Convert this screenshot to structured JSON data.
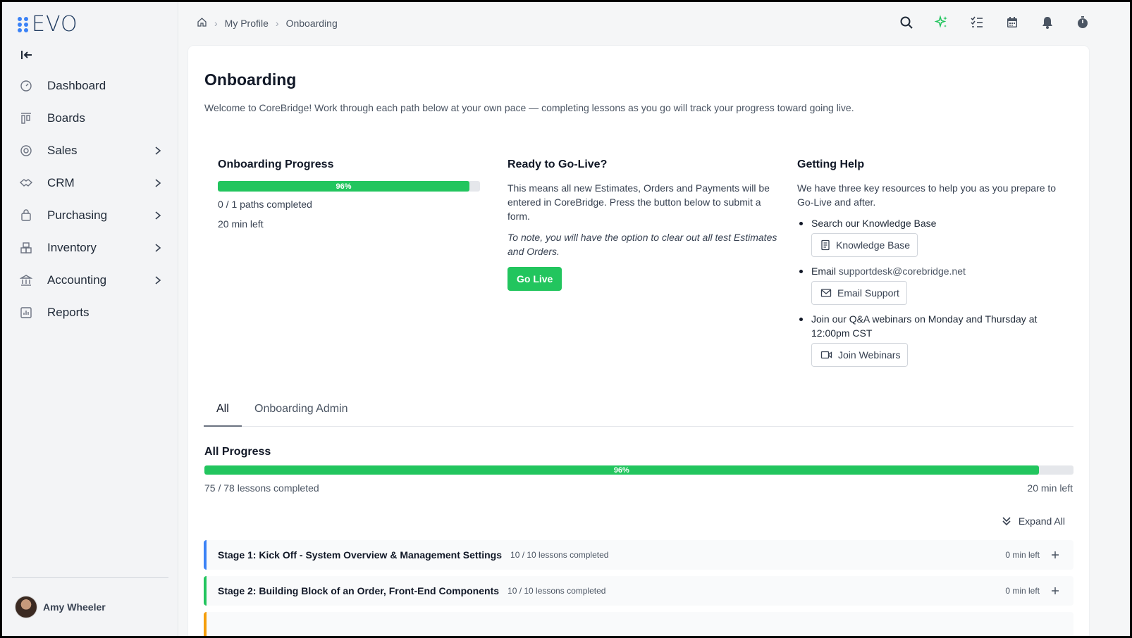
{
  "app": {
    "logo_text": "EVO"
  },
  "sidebar": {
    "items": [
      {
        "label": "Dashboard",
        "icon": "dashboard-icon",
        "has_submenu": false
      },
      {
        "label": "Boards",
        "icon": "boards-icon",
        "has_submenu": false
      },
      {
        "label": "Sales",
        "icon": "sales-icon",
        "has_submenu": true
      },
      {
        "label": "CRM",
        "icon": "crm-icon",
        "has_submenu": true
      },
      {
        "label": "Purchasing",
        "icon": "purchasing-icon",
        "has_submenu": true
      },
      {
        "label": "Inventory",
        "icon": "inventory-icon",
        "has_submenu": true
      },
      {
        "label": "Accounting",
        "icon": "accounting-icon",
        "has_submenu": true
      },
      {
        "label": "Reports",
        "icon": "reports-icon",
        "has_submenu": false
      }
    ],
    "user_name": "Amy Wheeler"
  },
  "breadcrumb": {
    "items": [
      "My Profile",
      "Onboarding"
    ]
  },
  "topbar": {
    "icons": [
      "search-icon",
      "sparkle-icon",
      "tasks-icon",
      "calendar-icon",
      "bell-icon",
      "stopwatch-icon"
    ]
  },
  "page": {
    "title": "Onboarding",
    "welcome": "Welcome to CoreBridge! Work through each path below at your own pace — completing lessons as you go will track your progress toward going live."
  },
  "progress_card": {
    "title": "Onboarding Progress",
    "percent": 96,
    "percent_label": "96%",
    "paths_completed": "0 / 1 paths completed",
    "time_left": "20 min left"
  },
  "golive_card": {
    "title": "Ready to Go-Live?",
    "body": "This means all new Estimates, Orders and Payments will be entered in CoreBridge. Press the button below to submit a form.",
    "note": "To note, you will have the option to clear out all test Estimates and Orders.",
    "button": "Go Live"
  },
  "help_card": {
    "title": "Getting Help",
    "intro": "We have three key resources to help you as you prepare to Go-Live and after.",
    "item1_text": "Search our Knowledge Base",
    "item1_button": "Knowledge Base",
    "item2_prefix": "Email",
    "item2_email": "supportdesk@corebridge.net",
    "item2_button": "Email Support",
    "item3_text": "Join our Q&A webinars on Monday and Thursday at 12:00pm CST",
    "item3_button": "Join Webinars"
  },
  "tabs": [
    {
      "label": "All",
      "active": true
    },
    {
      "label": "Onboarding Admin",
      "active": false
    }
  ],
  "all_progress": {
    "title": "All Progress",
    "percent": 96,
    "percent_label": "96%",
    "lessons_completed": "75 / 78 lessons completed",
    "time_left": "20 min left",
    "expand_all": "Expand All"
  },
  "stages": [
    {
      "title": "Stage 1: Kick Off - System Overview & Management Settings",
      "count": "10 / 10 lessons completed",
      "time_left": "0 min left",
      "color": "#3b82f6"
    },
    {
      "title": "Stage 2: Building Block of an Order, Front-End Components",
      "count": "10 / 10 lessons completed",
      "time_left": "0 min left",
      "color": "#22c55e"
    }
  ],
  "colors": {
    "accent_green": "#22c55e",
    "stage3_color": "#f59e0b"
  }
}
